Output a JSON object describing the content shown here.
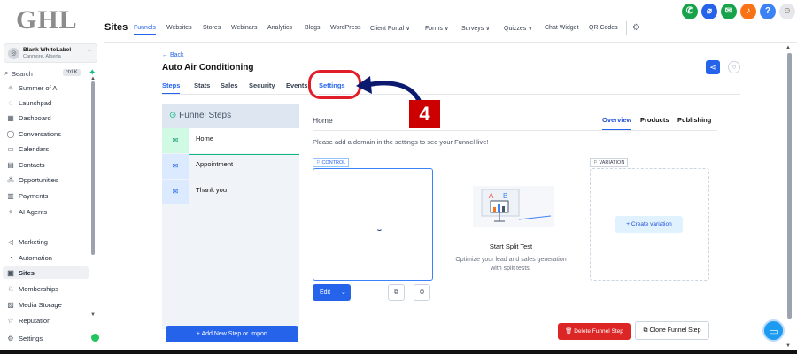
{
  "brand": {
    "logo": "GHL"
  },
  "account": {
    "name": "Blank WhiteLabel",
    "location": "Canmore, Alberta"
  },
  "search": {
    "label": "Search",
    "shortcut": "ctrl K"
  },
  "sidebar": {
    "items": [
      {
        "label": "Summer of AI",
        "icon": "sparkle-icon"
      },
      {
        "label": "Launchpad",
        "icon": "rocket-icon"
      },
      {
        "label": "Dashboard",
        "icon": "grid-icon"
      },
      {
        "label": "Conversations",
        "icon": "chat-icon"
      },
      {
        "label": "Calendars",
        "icon": "calendar-icon"
      },
      {
        "label": "Contacts",
        "icon": "contacts-icon"
      },
      {
        "label": "Opportunities",
        "icon": "opportunities-icon"
      },
      {
        "label": "Payments",
        "icon": "payments-icon"
      },
      {
        "label": "AI Agents",
        "icon": "ai-agents-icon"
      },
      {
        "label": "Marketing",
        "icon": "send-icon"
      },
      {
        "label": "Automation",
        "icon": "automation-icon"
      },
      {
        "label": "Sites",
        "icon": "sites-icon"
      },
      {
        "label": "Memberships",
        "icon": "memberships-icon"
      },
      {
        "label": "Media Storage",
        "icon": "media-icon"
      },
      {
        "label": "Reputation",
        "icon": "star-icon"
      },
      {
        "label": "Settings",
        "icon": "gear-icon"
      }
    ]
  },
  "topbar": {
    "title": "Sites",
    "nav": [
      "Funnels",
      "Websites",
      "Stores",
      "Webinars",
      "Analytics",
      "Blogs",
      "WordPress",
      "Client Portal ∨",
      "Forms ∨",
      "Surveys ∨",
      "Quizzes ∨",
      "Chat Widget",
      "QR Codes"
    ],
    "icons": [
      {
        "name": "phone-icon",
        "color": "#16a34a"
      },
      {
        "name": "status-icon",
        "color": "#2563eb"
      },
      {
        "name": "megaphone-icon",
        "color": "#16a34a"
      },
      {
        "name": "bell-icon",
        "color": "#f97316"
      },
      {
        "name": "help-icon",
        "color": "#3b82f6"
      }
    ]
  },
  "page": {
    "back": "← Back",
    "title": "Auto Air Conditioning",
    "tabs": [
      "Steps",
      "Stats",
      "Sales",
      "Security",
      "Events",
      "Settings"
    ]
  },
  "annotation": {
    "step_number": "4",
    "color": "#cc0000"
  },
  "steps": {
    "heading": "Funnel Steps",
    "items": [
      "Home",
      "Appointment",
      "Thank you"
    ],
    "add_button": "+ Add New Step or Import"
  },
  "content": {
    "title": "Home",
    "tabs": [
      "Overview",
      "Products",
      "Publishing"
    ],
    "domain_note": "Please add a domain in the settings to see your Funnel live!",
    "control_tag": "⚐ CONTROL",
    "variation_tag": "⚐ VARIATION",
    "edit_button": "Edit",
    "create_variation": "+ Create variation",
    "split_title": "Start Split Test",
    "split_desc": "Optimize your lead and sales generation with split tests.",
    "delete_button": "Delete Funnel Step",
    "clone_button": "Clone Funnel Step"
  }
}
